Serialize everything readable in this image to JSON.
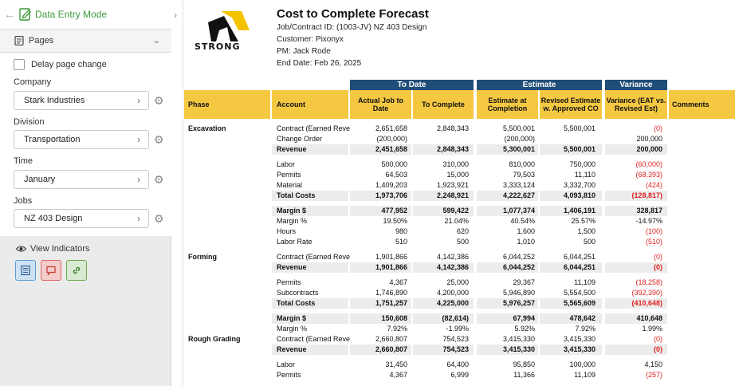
{
  "sidebar": {
    "mode_label": "Data Entry Mode",
    "pages_label": "Pages",
    "delay_label": "Delay page change",
    "fields": [
      {
        "label": "Company",
        "value": "Stark Industries"
      },
      {
        "label": "Division",
        "value": "Transportation"
      },
      {
        "label": "Time",
        "value": "January"
      },
      {
        "label": "Jobs",
        "value": "NZ 403 Design"
      }
    ],
    "indicators_label": "View Indicators",
    "indicator_colors": [
      "#5b9bd5",
      "#e06666",
      "#6aa84f"
    ]
  },
  "report": {
    "logo_text": "STRONG",
    "title": "Cost to Complete Forecast",
    "info": [
      "Job/Contract ID: (1003-JV) NZ 403 Design",
      "Customer: Pixonyx",
      "PM: Jack Rode",
      "End Date: Feb 26, 2025"
    ],
    "bands": {
      "to_date": "To Date",
      "estimate": "Estimate",
      "variance": "Variance"
    },
    "headers": {
      "phase": "Phase",
      "account": "Account",
      "actual": "Actual Job to Date",
      "to_complete": "To Complete",
      "est_completion": "Estimate at Completion",
      "revised": "Revised Estimate w. Approved CO",
      "variance": "Variance (EAT vs. Revised Est)",
      "comments": "Comments"
    },
    "colors": {
      "band": "#1f4e79",
      "header": "#f5c842",
      "negative": "#e02020"
    },
    "rows": [
      {
        "phase": "Excavation",
        "account": "Contract (Earned Reve",
        "v": [
          "2,651,658",
          "2,848,343",
          "5,500,001",
          "5,500,001",
          "(0)"
        ],
        "neg": true
      },
      {
        "phase": "",
        "account": "Change Order",
        "v": [
          "(200,000)",
          "",
          "(200,000)",
          "",
          "200,000"
        ]
      },
      {
        "phase": "",
        "account": "Revenue",
        "v": [
          "2,451,658",
          "2,848,343",
          "5,300,001",
          "5,500,001",
          "200,000"
        ],
        "bold": true
      },
      {
        "gap": true
      },
      {
        "phase": "",
        "account": "Labor",
        "v": [
          "500,000",
          "310,000",
          "810,000",
          "750,000",
          "(60,000)"
        ],
        "neg": true
      },
      {
        "phase": "",
        "account": "Permits",
        "v": [
          "64,503",
          "15,000",
          "79,503",
          "11,110",
          "(68,393)"
        ],
        "neg": true
      },
      {
        "phase": "",
        "account": "Material",
        "v": [
          "1,409,203",
          "1,923,921",
          "3,333,124",
          "3,332,700",
          "(424)"
        ],
        "neg": true
      },
      {
        "phase": "",
        "account": "Total Costs",
        "v": [
          "1,973,706",
          "2,248,921",
          "4,222,627",
          "4,093,810",
          "(128,817)"
        ],
        "bold": true,
        "neg": true
      },
      {
        "gap": true
      },
      {
        "phase": "",
        "account": "Margin $",
        "v": [
          "477,952",
          "599,422",
          "1,077,374",
          "1,406,191",
          "328,817"
        ],
        "bold": true
      },
      {
        "phase": "",
        "account": "Margin %",
        "v": [
          "19.50%",
          "21.04%",
          "40.54%",
          "25.57%",
          "-14.97%"
        ]
      },
      {
        "phase": "",
        "account": "Hours",
        "v": [
          "980",
          "620",
          "1,600",
          "1,500",
          "(100)"
        ],
        "neg": true
      },
      {
        "phase": "",
        "account": "Labor Rate",
        "v": [
          "510",
          "500",
          "1,010",
          "500",
          "(510)"
        ],
        "neg": true
      },
      {
        "gap": true
      },
      {
        "phase": "Forming",
        "account": "Contract (Earned Reve",
        "v": [
          "1,901,866",
          "4,142,386",
          "6,044,252",
          "6,044,251",
          "(0)"
        ],
        "neg": true
      },
      {
        "phase": "",
        "account": "Revenue",
        "v": [
          "1,901,866",
          "4,142,386",
          "6,044,252",
          "6,044,251",
          "(0)"
        ],
        "bold": true,
        "neg": true
      },
      {
        "gap": true
      },
      {
        "phase": "",
        "account": "Permits",
        "v": [
          "4,367",
          "25,000",
          "29,367",
          "11,109",
          "(18,258)"
        ],
        "neg": true
      },
      {
        "phase": "",
        "account": "Subcontracts",
        "v": [
          "1,746,890",
          "4,200,000",
          "5,946,890",
          "5,554,500",
          "(392,390)"
        ],
        "neg": true
      },
      {
        "phase": "",
        "account": "Total Costs",
        "v": [
          "1,751,257",
          "4,225,000",
          "5,976,257",
          "5,565,609",
          "(410,648)"
        ],
        "bold": true,
        "neg": true
      },
      {
        "gap": true
      },
      {
        "phase": "",
        "account": "Margin $",
        "v": [
          "150,608",
          "(82,614)",
          "67,994",
          "478,642",
          "410,648"
        ],
        "bold": true
      },
      {
        "phase": "",
        "account": "Margin %",
        "v": [
          "7.92%",
          "-1.99%",
          "5.92%",
          "7.92%",
          "1.99%"
        ]
      },
      {
        "phase": "Rough Grading",
        "account": "Contract (Earned Reve",
        "v": [
          "2,660,807",
          "754,523",
          "3,415,330",
          "3,415,330",
          "(0)"
        ],
        "neg": true
      },
      {
        "phase": "",
        "account": "Revenue",
        "v": [
          "2,660,807",
          "754,523",
          "3,415,330",
          "3,415,330",
          "(0)"
        ],
        "bold": true,
        "neg": true
      },
      {
        "gap": true
      },
      {
        "phase": "",
        "account": "Labor",
        "v": [
          "31,450",
          "64,400",
          "95,850",
          "100,000",
          "4,150"
        ]
      },
      {
        "phase": "",
        "account": "Permits",
        "v": [
          "4,367",
          "6,999",
          "11,366",
          "11,109",
          "(257)"
        ],
        "neg": true
      }
    ]
  }
}
